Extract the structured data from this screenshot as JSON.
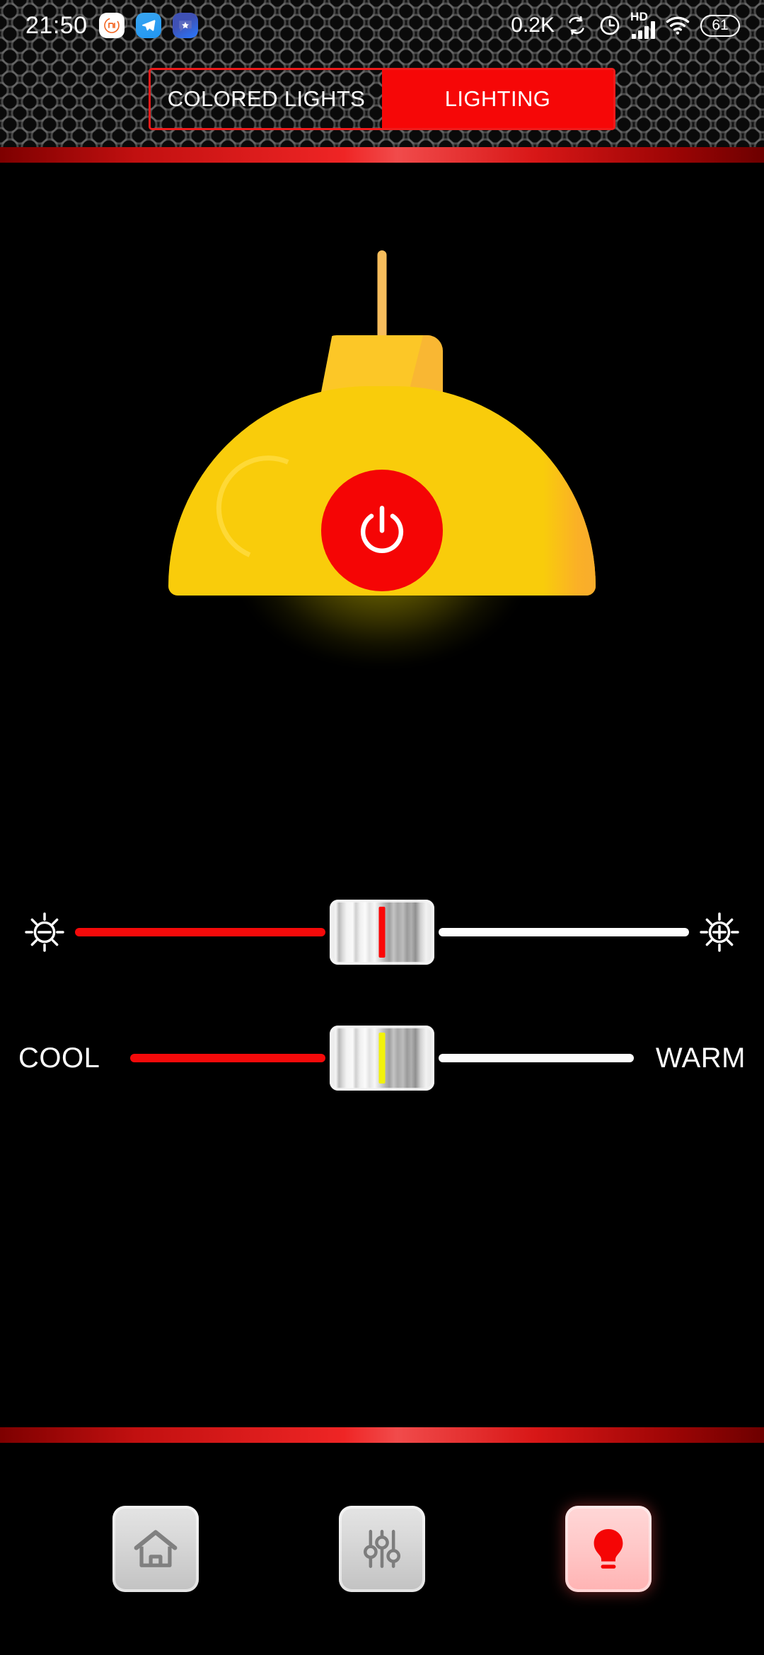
{
  "status_bar": {
    "time": "21:50",
    "network_speed": "0.2K",
    "hd_label": "HD",
    "battery_level": "61",
    "notification_icons": [
      "mi-app-icon",
      "telegram-icon",
      "chat-star-icon"
    ],
    "right_icons": [
      "sync-icon",
      "alarm-clock-icon",
      "hd-signal-icon",
      "wifi-icon",
      "battery-icon"
    ]
  },
  "header": {
    "tabs": [
      {
        "label": "COLORED LIGHTS",
        "active": false
      },
      {
        "label": "LIGHTING",
        "active": true
      }
    ]
  },
  "lamp": {
    "power_icon": "power-icon",
    "shade_color": "#f9cc0b",
    "power_button_color": "#f50505",
    "glow_color": "#ffee00"
  },
  "sliders": [
    {
      "id": "brightness",
      "left_icon": "brightness-low-icon",
      "right_icon": "brightness-high-icon",
      "left_label": "",
      "right_label": "",
      "fill_percent": 50,
      "thumb_line_color": "#fb0606"
    },
    {
      "id": "temperature",
      "left_icon": "",
      "right_icon": "",
      "left_label": "COOL",
      "right_label": "WARM",
      "fill_percent": 50,
      "thumb_line_color": "#f2f20a"
    }
  ],
  "bottom_nav": {
    "items": [
      {
        "name": "home",
        "icon": "home-icon",
        "active": false
      },
      {
        "name": "settings",
        "icon": "sliders-icon",
        "active": false
      },
      {
        "name": "lighting",
        "icon": "lightbulb-icon",
        "active": true
      }
    ]
  },
  "colors": {
    "accent_red": "#f60707",
    "lamp_yellow": "#f9cc0b",
    "track_active": "#f50a0a",
    "track_inactive": "#fdfdfd",
    "background": "#000000"
  }
}
